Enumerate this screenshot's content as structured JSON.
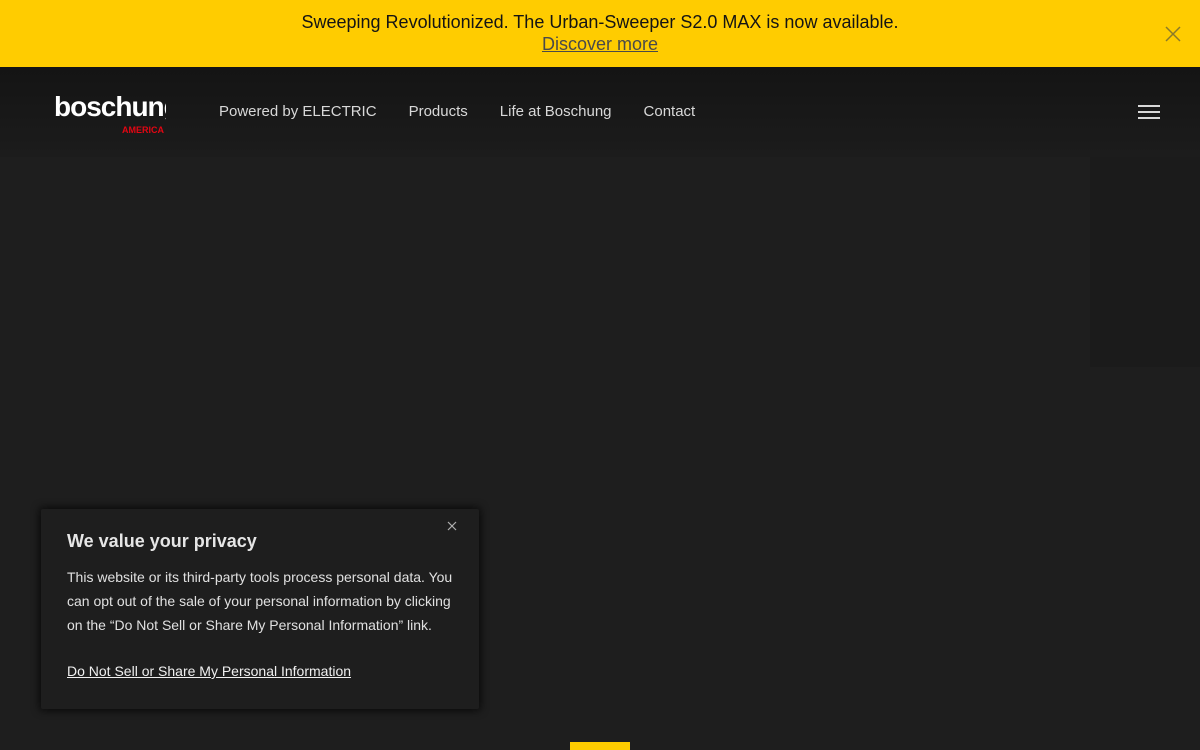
{
  "announcement": {
    "text": "Sweeping Revolutionized. The Urban-Sweeper S2.0 MAX is now available.",
    "link_label": "Discover more",
    "close_icon": "close-icon",
    "background_color": "#ffcc00"
  },
  "header": {
    "logo": {
      "wordmark": "boschung",
      "sub": "AMERICA",
      "accent_color": "#e30613"
    },
    "nav": [
      {
        "label": "Powered by ELECTRIC"
      },
      {
        "label": "Products"
      },
      {
        "label": "Life at Boschung"
      },
      {
        "label": "Contact"
      }
    ],
    "menu_icon": "hamburger-menu-icon"
  },
  "privacy": {
    "title": "We value your privacy",
    "body": "This website or its third-party tools process personal data. You can opt out of the sale of your personal information by clicking on the “Do Not Sell or Share My Personal Information” link.",
    "link_label": "Do Not Sell or Share My Personal Information",
    "close_icon": "close-icon"
  },
  "colors": {
    "brand_yellow": "#ffcc00",
    "background": "#1e1e1e"
  }
}
